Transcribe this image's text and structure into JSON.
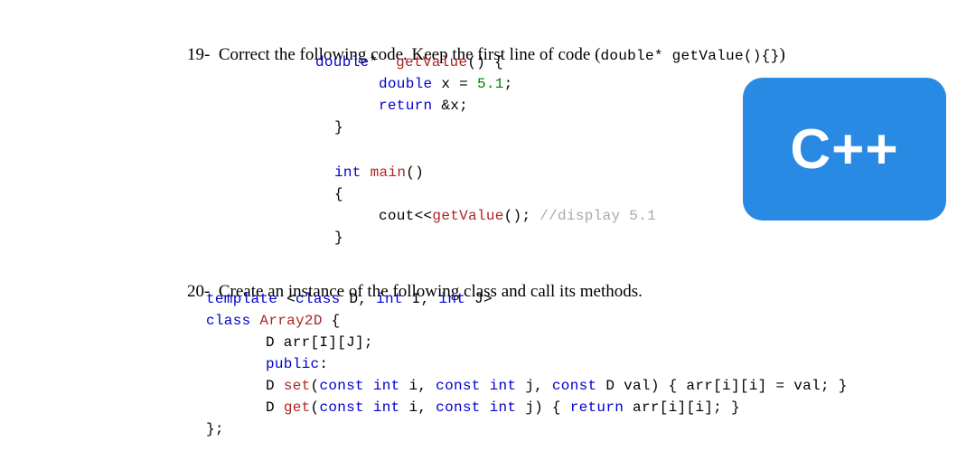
{
  "q19": {
    "prompt_prefix": "19-  Correct the following code. Keep the first line of code (",
    "prompt_code": "double* getValue(){}",
    "prompt_suffix": ")",
    "code": {
      "l1_kw1": "double",
      "l1_star": "*",
      "l1_name": "getValue",
      "l1_rest": "() {",
      "l2_kw": "double",
      "l2_rest": " x = ",
      "l2_num": "5.1",
      "l2_semi": ";",
      "l3_kw": "return",
      "l3_rest": " &x;",
      "l4": "}",
      "l5_kw": "int",
      "l5_name": " main",
      "l5_rest": "()",
      "l6": "{",
      "l7a": "cout<<",
      "l7_name": "getValue",
      "l7b": "(); ",
      "l7_comment": "//display 5.1",
      "l8": "}"
    },
    "badge": "C++"
  },
  "q20": {
    "prompt": "20-  Create an instance of the following class and call its methods.",
    "code": {
      "l1a": "template",
      "l1b": " <",
      "l1c": "class",
      "l1d": " D, ",
      "l1e": "int",
      "l1f": " I, ",
      "l1g": "int",
      "l1h": " J>",
      "l2a": "class",
      "l2b": " ",
      "l2c": "Array2D",
      "l2d": " {",
      "l3": "D arr[I][J];",
      "l4a": "public",
      "l4b": ":",
      "l5a": "D ",
      "l5b": "set",
      "l5c": "(",
      "l5d": "const int",
      "l5e": " i, ",
      "l5f": "const int",
      "l5g": " j, ",
      "l5h": "const",
      "l5i": " D val) { arr[i][i] = val; }",
      "l6a": "D ",
      "l6b": "get",
      "l6c": "(",
      "l6d": "const int",
      "l6e": " i, ",
      "l6f": "const int",
      "l6g": " j) { ",
      "l6h": "return",
      "l6i": " arr[i][i]; }",
      "l7": "};"
    }
  }
}
